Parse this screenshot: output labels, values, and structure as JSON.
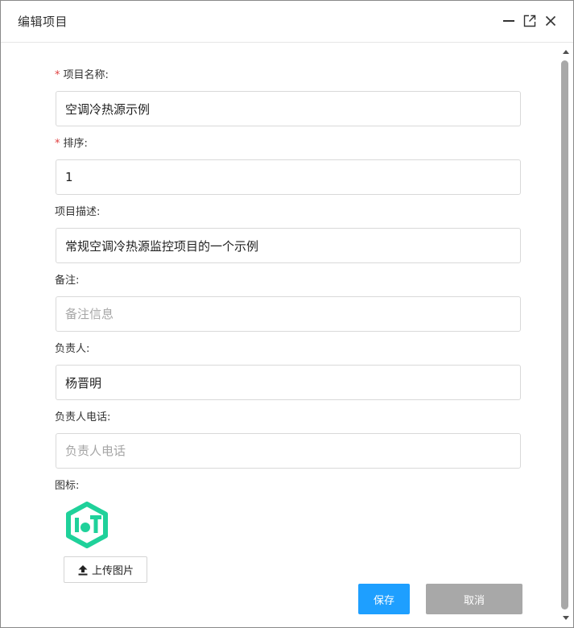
{
  "dialog": {
    "title": "编辑项目",
    "icons": {
      "minimize": "minimize-icon",
      "maximize": "maximize-icon",
      "close": "close-icon"
    }
  },
  "form": {
    "project_name": {
      "required_mark": "*",
      "label": "项目名称:",
      "value": "空调冷热源示例"
    },
    "sort": {
      "required_mark": "*",
      "label": "排序:",
      "value": "1"
    },
    "description": {
      "label": "项目描述:",
      "value": "常规空调冷热源监控项目的一个示例"
    },
    "remark": {
      "label": "备注:",
      "value": "",
      "placeholder": "备注信息"
    },
    "owner": {
      "label": "负责人:",
      "value": "杨晋明"
    },
    "owner_phone": {
      "label": "负责人电话:",
      "value": "",
      "placeholder": "负责人电话"
    },
    "icon": {
      "label": "图标:",
      "logo_icon": "iot-logo-icon",
      "upload_label": "上传图片",
      "upload_icon": "upload-icon"
    }
  },
  "buttons": {
    "save": "保存",
    "cancel": "取消"
  },
  "colors": {
    "primary": "#1e9fff",
    "cancel": "#a8a8a8",
    "required": "#e04040",
    "logo": "#1fd19a"
  }
}
